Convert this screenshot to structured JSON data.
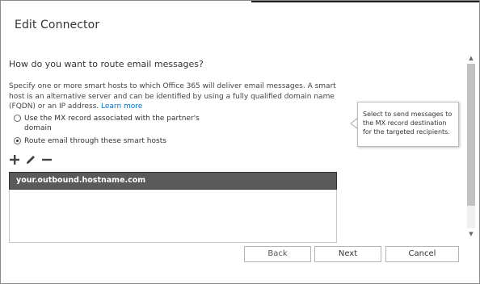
{
  "dialog": {
    "title": "Edit Connector"
  },
  "content": {
    "question": "How do you want to route email messages?",
    "description": "Specify one or more smart hosts to which Office 365 will deliver email messages. A smart host is an alternative server and can be identified by using a fully qualified domain name (FQDN) or an IP address.",
    "learn_more": "Learn more",
    "radio_options": [
      {
        "label_line1": "Use the MX record associated with the partner's",
        "label_line2": "domain",
        "checked": false
      },
      {
        "label_line1": "Route email through these smart hosts",
        "label_line2": "",
        "checked": true
      }
    ],
    "toolbar": {
      "add_icon": "plus-icon",
      "edit_icon": "pencil-icon",
      "remove_icon": "minus-icon"
    },
    "smart_hosts": [
      "your.outbound.hostname.com"
    ]
  },
  "callout": {
    "text": "Select to send messages to the MX record destination for the targeted recipients."
  },
  "buttons": {
    "back": "Back",
    "next": "Next",
    "cancel": "Cancel"
  },
  "colors": {
    "link": "#0072c6",
    "selected_row_bg": "#5a5a5a"
  }
}
